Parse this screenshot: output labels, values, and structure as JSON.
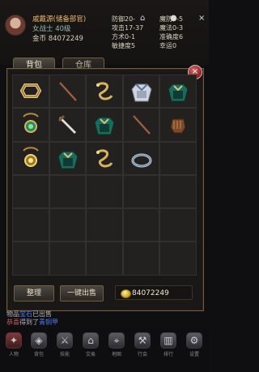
{
  "player": {
    "name": "戚戴源",
    "name_note": "(储备部官)",
    "level_text": "女战士 40级",
    "gold_text": "金币 84072249"
  },
  "stats": [
    {
      "label": "防御",
      "value": "20-"
    },
    {
      "label": "魔防",
      "value": "0-5"
    },
    {
      "label": "攻击",
      "value": "17-37"
    },
    {
      "label": "魔法",
      "value": "0-3"
    },
    {
      "label": "方术",
      "value": "0-1"
    },
    {
      "label": "准确度",
      "value": "6"
    },
    {
      "label": "敏捷度",
      "value": "5"
    },
    {
      "label": "幸运",
      "value": "0"
    }
  ],
  "tabs": {
    "bag": "背包",
    "warehouse": "仓库"
  },
  "inventory": {
    "rows": 6,
    "cols": 5,
    "items": [
      {
        "name": "gold-ring-icon"
      },
      {
        "name": "staff-icon"
      },
      {
        "name": "golden-whip-icon"
      },
      {
        "name": "white-armor-icon"
      },
      {
        "name": "green-armor-icon"
      },
      {
        "name": "green-amulet-icon"
      },
      {
        "name": "sword-icon"
      },
      {
        "name": "green-armor-icon"
      },
      {
        "name": "staff-icon"
      },
      {
        "name": "brown-gauntlet-icon"
      },
      {
        "name": "gold-amulet-icon"
      },
      {
        "name": "green-armor-icon"
      },
      {
        "name": "golden-whip-icon"
      },
      {
        "name": "silver-bracelet-icon"
      }
    ]
  },
  "buttons": {
    "sort": "整理",
    "sell_all": "一键出售"
  },
  "currency": {
    "value": "84072249"
  },
  "chat": {
    "line1_prefix": "物品",
    "line1_link": "宝石",
    "line1_suffix": "已出售",
    "line2_prefix": "恭喜",
    "line2_mid": "得到了",
    "line2_item": "青铜甲"
  },
  "bottom_nav": [
    {
      "label": "人物"
    },
    {
      "label": "背包"
    },
    {
      "label": "技能"
    },
    {
      "label": "交易"
    },
    {
      "label": "地图"
    },
    {
      "label": "行会"
    },
    {
      "label": "排行"
    },
    {
      "label": "设置"
    }
  ]
}
